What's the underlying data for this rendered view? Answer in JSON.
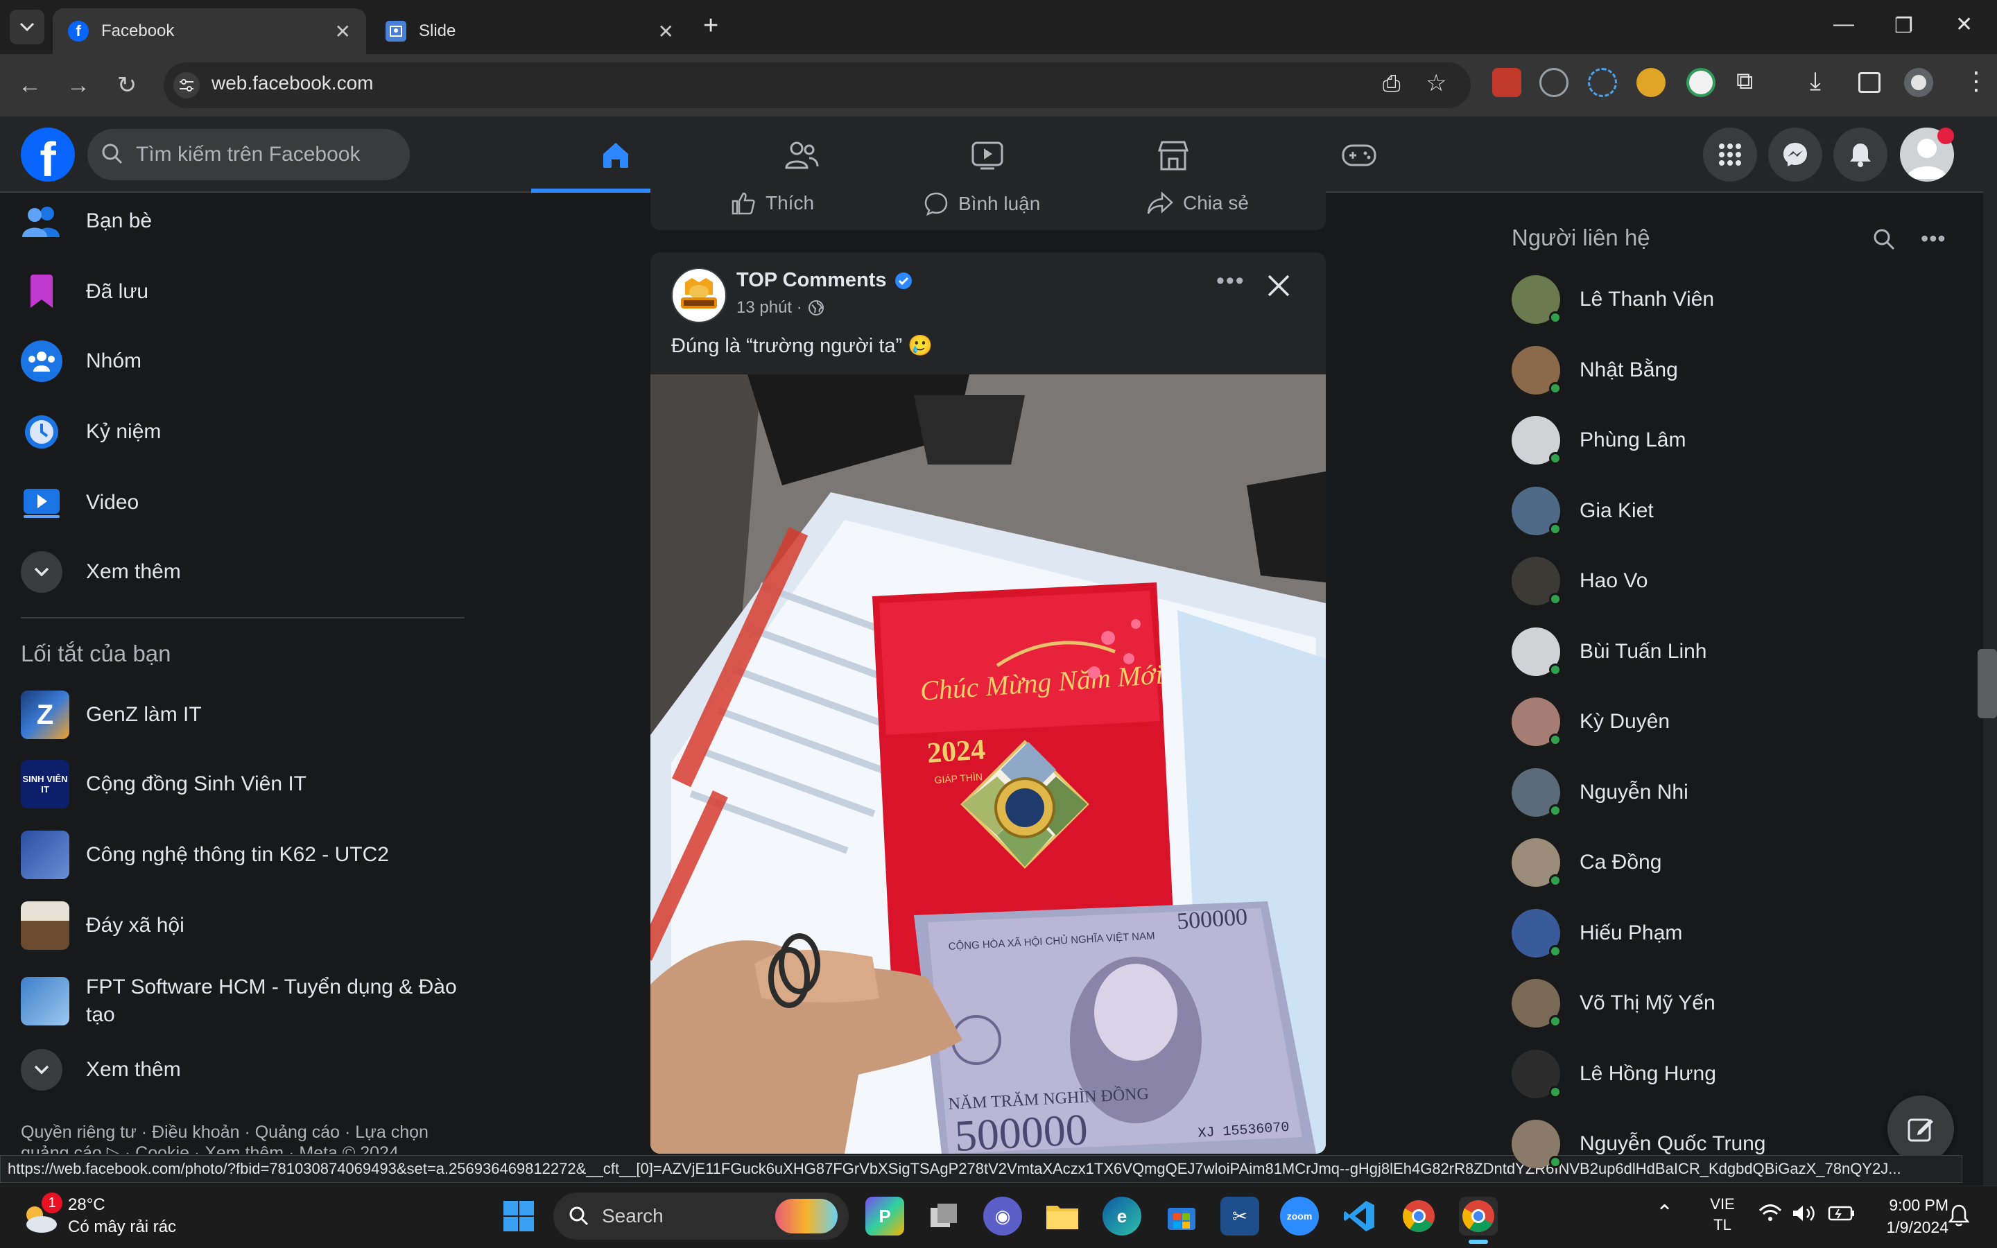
{
  "browser": {
    "tabs": [
      {
        "title": "Facebook",
        "active": true
      },
      {
        "title": "Slide",
        "active": false
      }
    ],
    "url": "web.facebook.com",
    "status_url": "https://web.facebook.com/photo/?fbid=781030874069493&set=a.256936469812272&__cft__[0]=AZVjE11FGuck6uXHG87FGrVbXSigTSAgP278tV2VmtaXAczx1TX6VQmgQEJ7wloiPAim81MCrJmq--gHgj8lEh4G82rR8ZDntdYZR6INVB2up6dlHdBaICR_KdgbdQBiGazX_78nQY2J..."
  },
  "fb": {
    "search_placeholder": "Tìm kiếm trên Facebook",
    "left_menu": [
      {
        "label": "Bạn bè",
        "icon": "friends-icon"
      },
      {
        "label": "Đã lưu",
        "icon": "saved-icon"
      },
      {
        "label": "Nhóm",
        "icon": "groups-icon"
      },
      {
        "label": "Kỷ niệm",
        "icon": "memories-icon"
      },
      {
        "label": "Video",
        "icon": "video-icon"
      },
      {
        "label": "Xem thêm",
        "icon": "chevron-down-icon"
      }
    ],
    "shortcuts_title": "Lối tắt của bạn",
    "shortcuts": [
      {
        "label": "GenZ làm IT"
      },
      {
        "label": "Cộng đồng Sinh Viên IT"
      },
      {
        "label": "Công nghệ thông tin K62 - UTC2"
      },
      {
        "label": "Đáy xã hội"
      },
      {
        "label": "FPT Software HCM - Tuyển dụng & Đào tạo"
      }
    ],
    "shortcuts_more": "Xem thêm",
    "footer_line1": "Quyền riêng tư · Điều khoản · Quảng cáo · Lựa chọn",
    "footer_line2": "quảng cáo ▷ · Cookie · Xem thêm · Meta © 2024",
    "prev_post_actions": {
      "like": "Thích",
      "comment": "Bình luận",
      "share": "Chia sẻ"
    },
    "post": {
      "author": "TOP Comments",
      "time": "13 phút ·",
      "text": "Đúng là “trường người ta” 🥲",
      "photo_labels": {
        "envelope_greeting": "Chúc Mừng Năm Mới",
        "envelope_year": "2024",
        "envelope_zodiac": "GIÁP THÌN",
        "banknote_country": "CỘNG HÒA XÃ HỘI CHỦ NGHĨA VIỆT NAM",
        "banknote_value": "500000",
        "banknote_words": "NĂM TRĂM NGHÌN ĐỒNG",
        "banknote_serial": "XJ 15536070"
      }
    },
    "contacts_title": "Người liên hệ",
    "contacts": [
      {
        "name": "Lê Thanh Viên",
        "color": "#6b7a4f"
      },
      {
        "name": "Nhật Bằng",
        "color": "#8a6a4a"
      },
      {
        "name": "Phùng Lâm",
        "color": "#d0d2d5"
      },
      {
        "name": "Gia Kiet",
        "color": "#4f6a86"
      },
      {
        "name": "Hao Vo",
        "color": "#3c3a35"
      },
      {
        "name": "Bùi Tuấn Linh",
        "color": "#d0d2d5"
      },
      {
        "name": "Kỳ Duyên",
        "color": "#a57d72"
      },
      {
        "name": "Nguyễn Nhi",
        "color": "#5c6b7a"
      },
      {
        "name": "Ca Đồng",
        "color": "#9c8c7a"
      },
      {
        "name": "Hiếu Phạm",
        "color": "#3a5b9a"
      },
      {
        "name": "Võ Thị Mỹ Yến",
        "color": "#7a6a55"
      },
      {
        "name": "Lê Hồng Hưng",
        "color": "#2c2c2c"
      },
      {
        "name": "Nguyễn Quốc Trung",
        "color": "#8a7a6a"
      }
    ]
  },
  "taskbar": {
    "weather_temp": "28°C",
    "weather_desc": "Có mây rải rác",
    "weather_badge": "1",
    "search": "Search",
    "lang1": "VIE",
    "lang2": "TL",
    "time": "9:00 PM",
    "date": "1/9/2024"
  },
  "colors": {
    "accent": "#2d88ff",
    "fb_blue": "#0866ff",
    "online": "#31a24c"
  }
}
